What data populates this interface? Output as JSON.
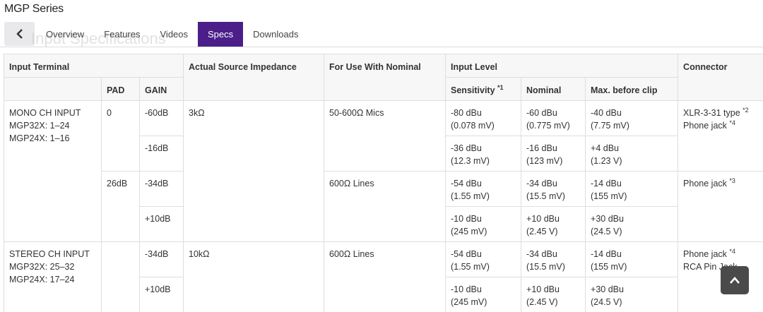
{
  "header": {
    "series_title": "MGP Series",
    "ghost_title": "Input Specifications",
    "tabs": [
      {
        "label": "Overview",
        "active": false
      },
      {
        "label": "Features",
        "active": false
      },
      {
        "label": "Videos",
        "active": false
      },
      {
        "label": "Specs",
        "active": true
      },
      {
        "label": "Downloads",
        "active": false
      }
    ],
    "active_tab_color": "#4b1e8a"
  },
  "table": {
    "headers": {
      "input_terminal": "Input Terminal",
      "pad": "PAD",
      "gain": "GAIN",
      "impedance": "Actual Source Impedance",
      "nominal_use": "For Use With Nominal",
      "input_level": "Input Level",
      "sensitivity": "Sensitivity",
      "sensitivity_note": "*1",
      "nominal": "Nominal",
      "max_clip": "Max. before clip",
      "connector": "Connector"
    },
    "mono": {
      "terminal": [
        "MONO CH INPUT",
        "MGP32X: 1–24",
        "MGP24X: 1–16"
      ],
      "pad_0": "0",
      "pad_26": "26dB",
      "impedance": "3kΩ",
      "use_mics": "50-600Ω Mics",
      "use_lines": "600Ω Lines",
      "connector_xlr": "XLR-3-31 type",
      "connector_xlr_note": "*2",
      "connector_phone": "Phone jack",
      "connector_phone_note": "*4",
      "connector_phone2": "Phone jack",
      "connector_phone2_note": "*3",
      "rows": [
        {
          "gain": "-60dB",
          "sens": [
            "-80 dBu",
            "(0.078 mV)"
          ],
          "nom": [
            "-60 dBu",
            "(0.775 mV)"
          ],
          "max": [
            "-40 dBu",
            "(7.75 mV)"
          ]
        },
        {
          "gain": "-16dB",
          "sens": [
            "-36 dBu",
            "(12.3 mV)"
          ],
          "nom": [
            "-16 dBu",
            "(123 mV)"
          ],
          "max": [
            "+4 dBu",
            "(1.23 V)"
          ]
        },
        {
          "gain": "-34dB",
          "sens": [
            "-54 dBu",
            "(1.55 mV)"
          ],
          "nom": [
            "-34 dBu",
            "(15.5 mV)"
          ],
          "max": [
            "-14 dBu",
            "(155 mV)"
          ]
        },
        {
          "gain": "+10dB",
          "sens": [
            "-10 dBu",
            "(245 mV)"
          ],
          "nom": [
            "+10 dBu",
            "(2.45 V)"
          ],
          "max": [
            "+30 dBu",
            "(24.5 V)"
          ]
        }
      ]
    },
    "stereo": {
      "terminal": [
        "STEREO CH INPUT",
        "MGP32X: 25–32",
        "MGP24X: 17–24"
      ],
      "impedance": "10kΩ",
      "use": "600Ω Lines",
      "connector_phone": "Phone jack",
      "connector_phone_note": "*4",
      "connector_rca": "RCA Pin Jack",
      "rows": [
        {
          "gain": "-34dB",
          "sens": [
            "-54 dBu",
            "(1.55 mV)"
          ],
          "nom": [
            "-34 dBu",
            "(15.5 mV)"
          ],
          "max": [
            "-14 dBu",
            "(155 mV)"
          ]
        },
        {
          "gain": "+10dB",
          "sens": [
            "-10 dBu",
            "(245 mV)"
          ],
          "nom": [
            "+10 dBu",
            "(2.45 V)"
          ],
          "max": [
            "+30 dBu",
            "(24.5 V)"
          ]
        }
      ]
    }
  },
  "icons": {
    "back": "chevron-left-icon",
    "scroll_top": "chevron-up-icon"
  }
}
